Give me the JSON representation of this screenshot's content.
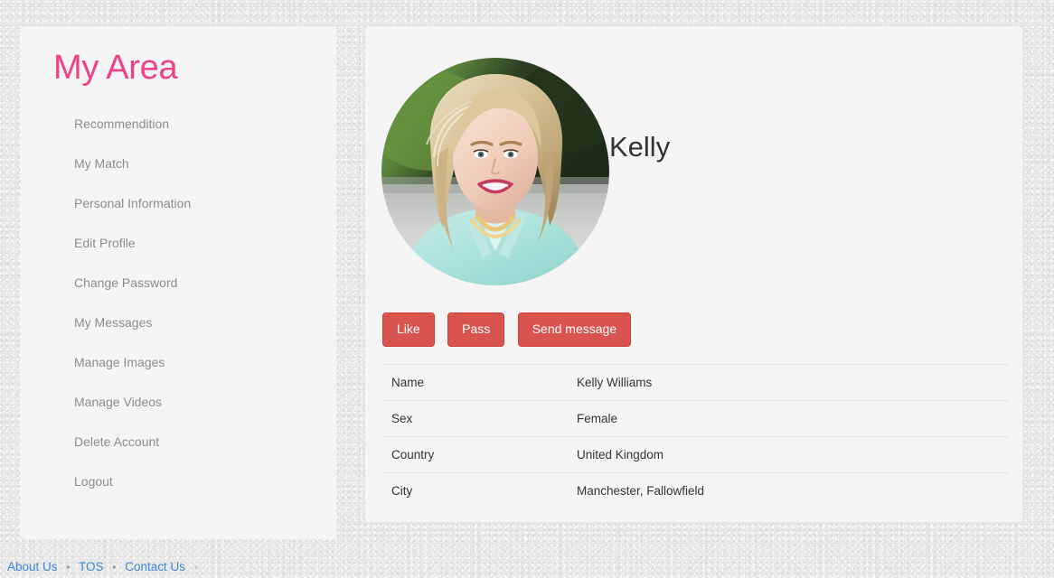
{
  "sidebar": {
    "title": "My Area",
    "items": [
      {
        "label": "Recommendition"
      },
      {
        "label": "My Match"
      },
      {
        "label": "Personal Information"
      },
      {
        "label": "Edit Profile"
      },
      {
        "label": "Change Password"
      },
      {
        "label": "My Messages"
      },
      {
        "label": "Manage Images"
      },
      {
        "label": "Manage Videos"
      },
      {
        "label": "Delete Account"
      },
      {
        "label": "Logout"
      }
    ]
  },
  "profile": {
    "display_name": "Kelly",
    "avatar_alt": "profile-photo-kelly",
    "actions": [
      {
        "label": "Like",
        "name": "like-button"
      },
      {
        "label": "Pass",
        "name": "pass-button"
      },
      {
        "label": "Send message",
        "name": "send-message-button"
      }
    ],
    "details": [
      {
        "label": "Name",
        "value": "Kelly Williams"
      },
      {
        "label": "Sex",
        "value": "Female"
      },
      {
        "label": "Country",
        "value": "United Kingdom"
      },
      {
        "label": "City",
        "value": "Manchester, Fallowfield"
      }
    ]
  },
  "footer": {
    "links": [
      {
        "label": "About Us"
      },
      {
        "label": "TOS"
      },
      {
        "label": "Contact Us"
      }
    ],
    "separator": "•"
  },
  "colors": {
    "accent_pink": "#f0418a",
    "button_red": "#d9534f",
    "link_blue": "#3c87d8",
    "panel_bg": "#f5f5f5",
    "page_bg": "#e7e7e7",
    "text": "#333333",
    "nav_text": "#8c8c8c"
  }
}
